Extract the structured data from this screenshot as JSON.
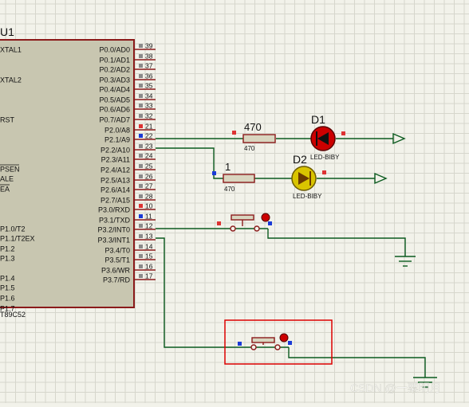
{
  "chip": {
    "name": "U1",
    "part": "T89C52",
    "left_pins": [
      {
        "label": "XTAL1"
      },
      {
        "label": "XTAL2"
      },
      {
        "label": "RST"
      },
      {
        "label": "PSEN",
        "overline": true
      },
      {
        "label": "ALE"
      },
      {
        "label": "EA",
        "overline": true
      },
      {
        "label": "P1.0/T2"
      },
      {
        "label": "P1.1/T2EX"
      },
      {
        "label": "P1.2"
      },
      {
        "label": "P1.3"
      },
      {
        "label": "P1.4"
      },
      {
        "label": "P1.5"
      },
      {
        "label": "P1.6"
      },
      {
        "label": "P1.7"
      }
    ],
    "right_pins": [
      {
        "label": "P0.0/AD0",
        "num": "39"
      },
      {
        "label": "P0.1/AD1",
        "num": "38"
      },
      {
        "label": "P0.2/AD2",
        "num": "37"
      },
      {
        "label": "P0.3/AD3",
        "num": "36"
      },
      {
        "label": "P0.4/AD4",
        "num": "35"
      },
      {
        "label": "P0.5/AD5",
        "num": "34"
      },
      {
        "label": "P0.6/AD6",
        "num": "33"
      },
      {
        "label": "P0.7/AD7",
        "num": "32"
      },
      {
        "label": "P2.0/A8",
        "num": "21"
      },
      {
        "label": "P2.1/A9",
        "num": "22"
      },
      {
        "label": "P2.2/A10",
        "num": "23"
      },
      {
        "label": "P2.3/A11",
        "num": "24"
      },
      {
        "label": "P2.4/A12",
        "num": "25"
      },
      {
        "label": "P2.5/A13",
        "num": "26"
      },
      {
        "label": "P2.6/A14",
        "num": "27"
      },
      {
        "label": "P2.7/A15",
        "num": "28"
      },
      {
        "label": "P3.0/RXD",
        "num": "10"
      },
      {
        "label": "P3.1/TXD",
        "num": "11"
      },
      {
        "label": "P3.2/INT0",
        "num": "12"
      },
      {
        "label": "P3.3/INT1",
        "num": "13"
      },
      {
        "label": "P3.4/T0",
        "num": "14"
      },
      {
        "label": "P3.5/T1",
        "num": "15"
      },
      {
        "label": "P3.6/WR",
        "num": "16"
      },
      {
        "label": "P3.7/RD",
        "num": "17"
      }
    ]
  },
  "resistors": [
    {
      "ref": "470",
      "value": "470"
    },
    {
      "ref": "1",
      "value": "470"
    }
  ],
  "leds": [
    {
      "ref": "D1",
      "part": "LED-BIBY",
      "color": "#cc0000"
    },
    {
      "ref": "D2",
      "part": "LED-BIBY",
      "color": "#d9c400"
    }
  ],
  "watermark": "CSDN @一粟明月",
  "colors": {
    "background": "#f2f2ea",
    "grid": "#d6d6cc",
    "chip_body": "#c8c6b0",
    "chip_outline": "#8b1a1a",
    "wire": "#0a5a1e",
    "pin_red": "#cc0000",
    "pin_blue": "#1a3ad6",
    "selection_box": "#dd0000"
  }
}
